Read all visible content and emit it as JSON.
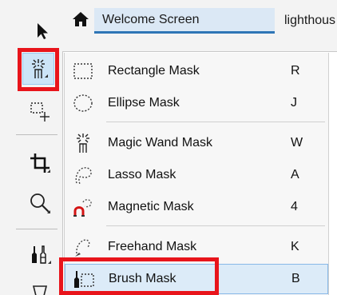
{
  "tabs": {
    "home_icon": "home-icon",
    "items": [
      {
        "label": "Welcome Screen"
      },
      {
        "label": "lighthous"
      }
    ]
  },
  "toolbar": {
    "tools": [
      {
        "name": "pick-tool",
        "icon": "arrow-cursor-icon"
      },
      {
        "name": "mask-tool",
        "icon": "magic-wand-icon",
        "selected": true,
        "highlighted": true
      },
      {
        "name": "mask-transform-tool",
        "icon": "mask-transform-icon"
      },
      {
        "name": "crop-tool",
        "icon": "crop-icon"
      },
      {
        "name": "zoom-tool",
        "icon": "magnifier-icon"
      },
      {
        "name": "brush-tools",
        "icon": "brush-tools-icon"
      },
      {
        "name": "fill-tool",
        "icon": "fill-icon"
      }
    ]
  },
  "menu": {
    "items": [
      {
        "label": "Rectangle Mask",
        "shortcut": "R",
        "icon": "rectangle-mask-icon"
      },
      {
        "label": "Ellipse Mask",
        "shortcut": "J",
        "icon": "ellipse-mask-icon"
      },
      {
        "label": "Magic Wand Mask",
        "shortcut": "W",
        "icon": "magic-wand-icon"
      },
      {
        "label": "Lasso Mask",
        "shortcut": "A",
        "icon": "lasso-icon"
      },
      {
        "label": "Magnetic Mask",
        "shortcut": "4",
        "icon": "magnetic-lasso-icon"
      },
      {
        "label": "Freehand Mask",
        "shortcut": "K",
        "icon": "freehand-mask-icon"
      },
      {
        "label": "Brush Mask",
        "shortcut": "B",
        "icon": "brush-mask-icon",
        "hovered": true,
        "highlighted": true
      }
    ]
  },
  "colors": {
    "highlight": "#e8141b",
    "hover": "#dcebf8",
    "accent": "#2e75b6"
  }
}
